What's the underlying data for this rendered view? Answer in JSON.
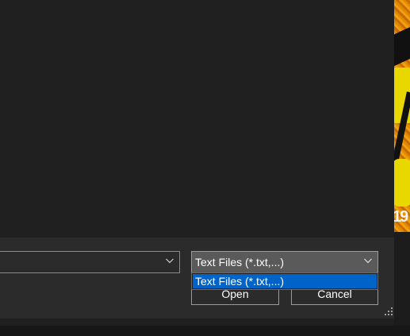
{
  "file_dialog": {
    "file_name": {
      "value": ""
    },
    "file_type": {
      "selected": "Text Files (*.txt,...)",
      "options": [
        "Text Files (*.txt,...)"
      ],
      "highlighted_index": 0
    },
    "buttons": {
      "open": "Open",
      "cancel": "Cancel"
    }
  },
  "wallpaper": {
    "text": "19"
  },
  "icons": {
    "name_dropdown": "chevron-down-icon",
    "type_dropdown": "chevron-down-icon",
    "resize": "resize-grip-icon"
  },
  "colors": {
    "selection": "#0063c8",
    "dialog_bg": "#202020",
    "pane_bg": "#2b2b2b"
  }
}
